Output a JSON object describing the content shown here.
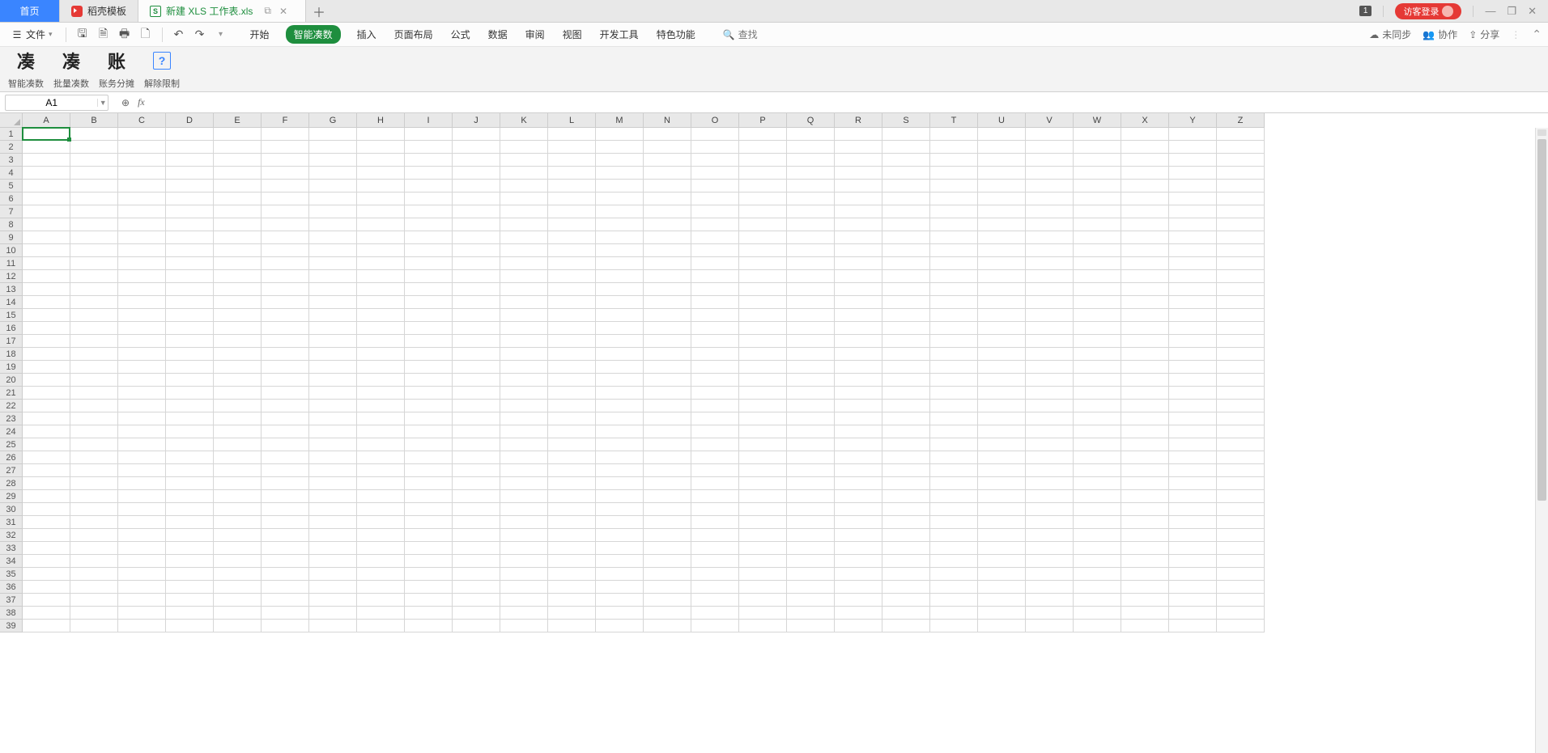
{
  "tabs": {
    "home": "首页",
    "template": "稻壳模板",
    "file": "新建 XLS 工作表.xls"
  },
  "window": {
    "badge": "1",
    "login": "访客登录"
  },
  "toolbar": {
    "file_label": "文件",
    "menu": [
      "开始",
      "智能凑数",
      "插入",
      "页面布局",
      "公式",
      "数据",
      "审阅",
      "视图",
      "开发工具",
      "特色功能"
    ],
    "search": "查找",
    "unsync": "未同步",
    "collab": "协作",
    "share": "分享"
  },
  "ribbon": {
    "items": [
      {
        "big": "凑",
        "label": "智能凑数"
      },
      {
        "big": "凑",
        "label": "批量凑数"
      },
      {
        "big": "账",
        "label": "账务分摊"
      },
      {
        "big": "?",
        "label": "解除限制"
      }
    ]
  },
  "namebox": {
    "value": "A1"
  },
  "formula": {
    "value": ""
  },
  "columns": [
    "A",
    "B",
    "C",
    "D",
    "E",
    "F",
    "G",
    "H",
    "I",
    "J",
    "K",
    "L",
    "M",
    "N",
    "O",
    "P",
    "Q",
    "R",
    "S",
    "T",
    "U",
    "V",
    "W",
    "X",
    "Y",
    "Z"
  ],
  "row_count": 39,
  "selected": {
    "row": 1,
    "col": "A"
  }
}
